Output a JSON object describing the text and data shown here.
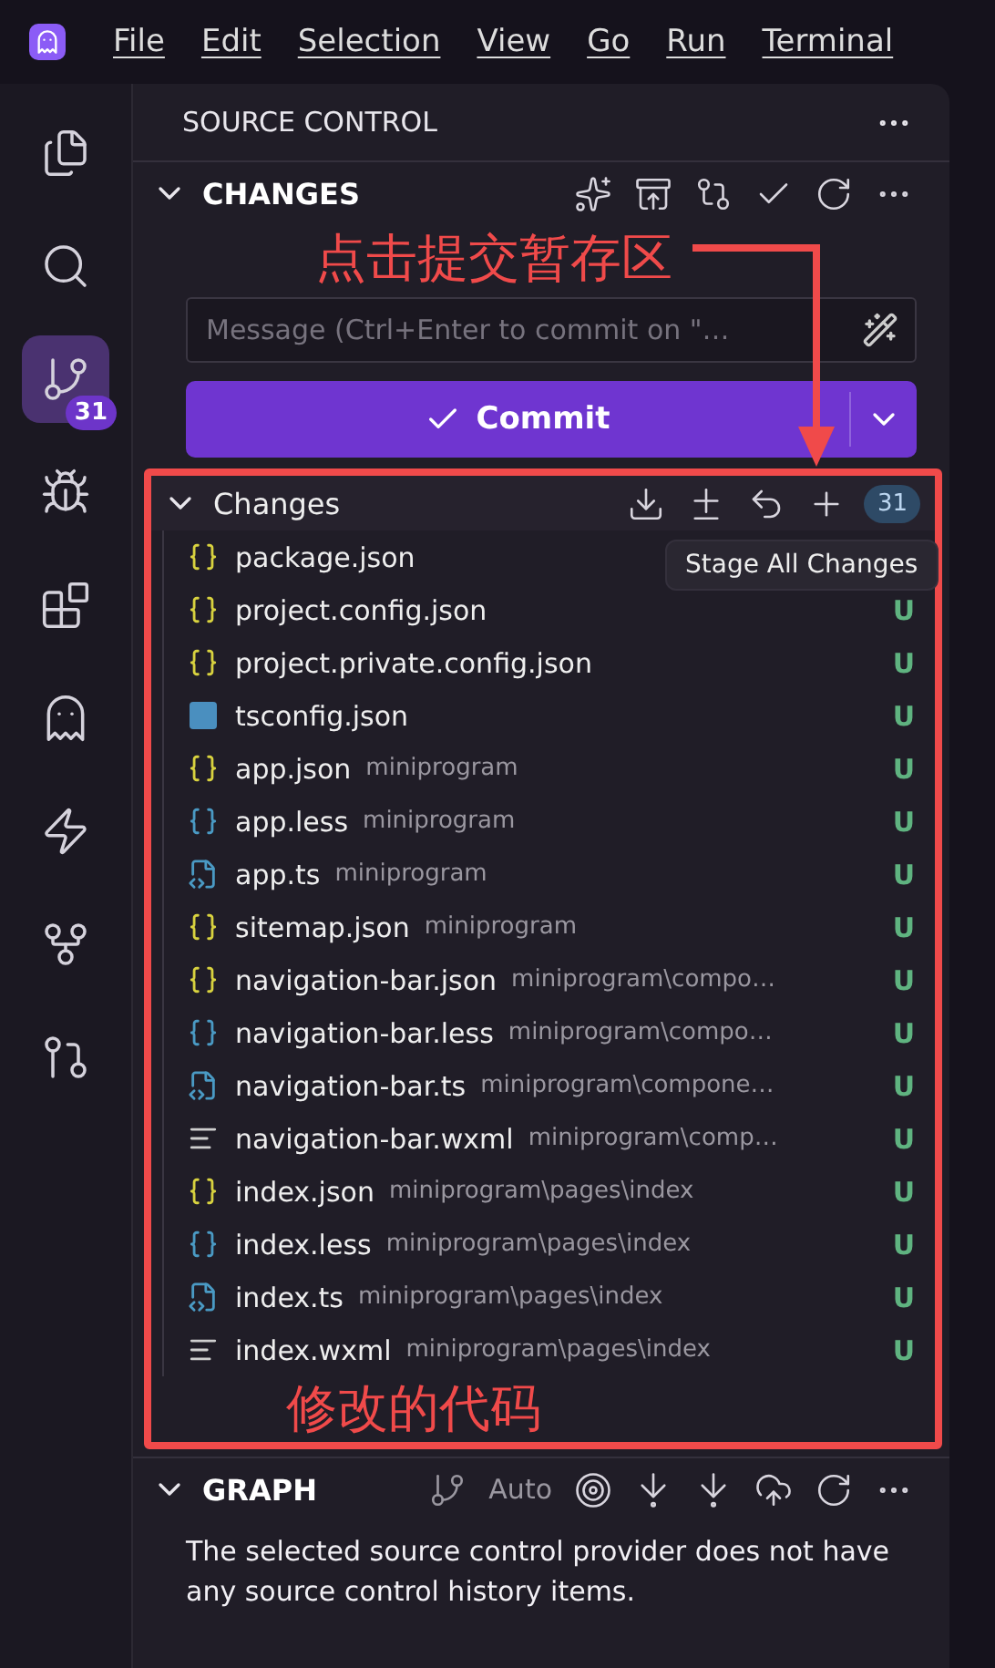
{
  "menu": [
    "File",
    "Edit",
    "Selection",
    "View",
    "Go",
    "Run",
    "Terminal"
  ],
  "activity": [
    {
      "kind": "files",
      "selected": false
    },
    {
      "kind": "search",
      "selected": false
    },
    {
      "kind": "scm",
      "selected": true,
      "badge": "31"
    },
    {
      "kind": "debug",
      "selected": false
    },
    {
      "kind": "extensions",
      "selected": false
    },
    {
      "kind": "ghost",
      "selected": false
    },
    {
      "kind": "zap",
      "selected": false
    },
    {
      "kind": "git",
      "selected": false
    },
    {
      "kind": "gitpr",
      "selected": false
    }
  ],
  "panel": {
    "title": "SOURCE CONTROL"
  },
  "changes_section": {
    "title": "CHANGES",
    "expanded": true,
    "placeholder": "Message (Ctrl+Enter to commit on \"…",
    "commit_label": "Commit"
  },
  "group": {
    "title": "Changes",
    "count": "31",
    "tooltip": "Stage All Changes"
  },
  "files": [
    {
      "kind": "json",
      "name": "package.json"
    },
    {
      "kind": "json",
      "name": "project.config.json",
      "status": "U"
    },
    {
      "kind": "json",
      "name": "project.private.config.json",
      "status": "U"
    },
    {
      "kind": "tsconfig",
      "name": "tsconfig.json",
      "status": "U"
    },
    {
      "kind": "json",
      "name": "app.json",
      "path": "miniprogram",
      "status": "U"
    },
    {
      "kind": "less",
      "name": "app.less",
      "path": "miniprogram",
      "status": "U"
    },
    {
      "kind": "ts",
      "name": "app.ts",
      "path": "miniprogram",
      "status": "U"
    },
    {
      "kind": "json",
      "name": "sitemap.json",
      "path": "miniprogram",
      "status": "U"
    },
    {
      "kind": "json",
      "name": "navigation-bar.json",
      "path": "miniprogram\\compo…",
      "status": "U"
    },
    {
      "kind": "less",
      "name": "navigation-bar.less",
      "path": "miniprogram\\compo…",
      "status": "U"
    },
    {
      "kind": "ts",
      "name": "navigation-bar.ts",
      "path": "miniprogram\\compone…",
      "status": "U"
    },
    {
      "kind": "xml",
      "name": "navigation-bar.wxml",
      "path": "miniprogram\\comp…",
      "status": "U"
    },
    {
      "kind": "json",
      "name": "index.json",
      "path": "miniprogram\\pages\\index",
      "status": "U"
    },
    {
      "kind": "less",
      "name": "index.less",
      "path": "miniprogram\\pages\\index",
      "status": "U"
    },
    {
      "kind": "ts",
      "name": "index.ts",
      "path": "miniprogram\\pages\\index",
      "status": "U"
    },
    {
      "kind": "xml",
      "name": "index.wxml",
      "path": "miniprogram\\pages\\index",
      "status": "U"
    }
  ],
  "graph": {
    "title": "GRAPH",
    "expanded": true,
    "mode": "Auto",
    "message": "The selected source control provider does not have any source control history items."
  },
  "annotations": [
    {
      "kind": "callout",
      "text": "点击提交暂存区"
    },
    {
      "kind": "label",
      "text": "修改的代码"
    }
  ]
}
